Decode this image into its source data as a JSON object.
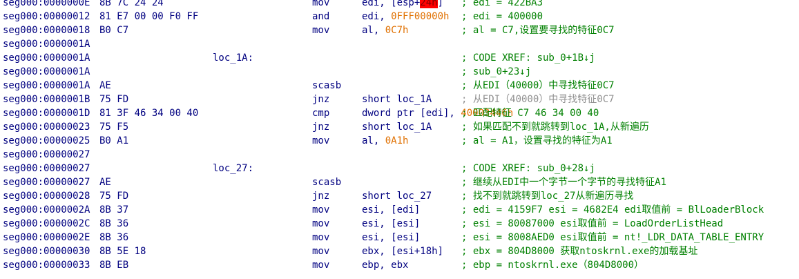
{
  "lines": [
    {
      "addr": "seg000:0000000E",
      "bytes": "8B 7C 24 24",
      "label": "",
      "mnem": "mov",
      "ops": [
        {
          "t": "edi, [esp+"
        },
        {
          "t": "24h",
          "k": "hl"
        },
        {
          "t": "]"
        }
      ],
      "comment": "; edi = 422BA3",
      "comment_style": "normal"
    },
    {
      "addr": "seg000:00000012",
      "bytes": "81 E7 00 00 F0 FF",
      "label": "",
      "mnem": "and",
      "ops": [
        {
          "t": "edi, "
        },
        {
          "t": "0FFF00000h",
          "k": "imm"
        }
      ],
      "comment": "; edi = 400000",
      "comment_style": "normal"
    },
    {
      "addr": "seg000:00000018",
      "bytes": "B0 C7",
      "label": "",
      "mnem": "mov",
      "ops": [
        {
          "t": "al, "
        },
        {
          "t": "0C7h",
          "k": "imm"
        }
      ],
      "comment": "; al = C7,设置要寻找的特征0C7",
      "comment_style": "normal"
    },
    {
      "addr": "seg000:0000001A",
      "bytes": "",
      "label": "",
      "mnem": "",
      "ops": [],
      "comment": "",
      "comment_style": "normal"
    },
    {
      "addr": "seg000:0000001A",
      "bytes": "",
      "label": "loc_1A:",
      "mnem": "",
      "ops": [],
      "comment": "; CODE XREF: sub_0+1B↓j",
      "comment_style": "normal"
    },
    {
      "addr": "seg000:0000001A",
      "bytes": "",
      "label": "",
      "mnem": "",
      "ops": [],
      "comment": "; sub_0+23↓j",
      "comment_style": "normal"
    },
    {
      "addr": "seg000:0000001A",
      "bytes": "AE",
      "label": "",
      "mnem": "scasb",
      "ops": [],
      "comment": "; 从EDI（40000）中寻找特征0C7",
      "comment_style": "normal"
    },
    {
      "addr": "seg000:0000001B",
      "bytes": "75 FD",
      "label": "",
      "mnem": "jnz",
      "ops": [
        {
          "t": "short loc_1A"
        }
      ],
      "comment": "; 从EDI（40000）中寻找特征0C7",
      "comment_style": "gray"
    },
    {
      "addr": "seg000:0000001D",
      "bytes": "81 3F 46 34 00 40",
      "label": "",
      "mnem": "cmp",
      "ops": [
        {
          "t": "dword ptr [edi], "
        },
        {
          "t": "40003446h",
          "k": "imm"
        }
      ],
      "comment": "; 匹配特征 C7 46 34 00 40",
      "comment_style": "normal"
    },
    {
      "addr": "seg000:00000023",
      "bytes": "75 F5",
      "label": "",
      "mnem": "jnz",
      "ops": [
        {
          "t": "short loc_1A"
        }
      ],
      "comment": "; 如果匹配不到就跳转到loc_1A,从新遍历",
      "comment_style": "normal"
    },
    {
      "addr": "seg000:00000025",
      "bytes": "B0 A1",
      "label": "",
      "mnem": "mov",
      "ops": [
        {
          "t": "al, "
        },
        {
          "t": "0A1h",
          "k": "imm"
        }
      ],
      "comment": "; al = A1，设置寻找的特征为A1",
      "comment_style": "normal"
    },
    {
      "addr": "seg000:00000027",
      "bytes": "",
      "label": "",
      "mnem": "",
      "ops": [],
      "comment": "",
      "comment_style": "normal"
    },
    {
      "addr": "seg000:00000027",
      "bytes": "",
      "label": "loc_27:",
      "mnem": "",
      "ops": [],
      "comment": "; CODE XREF: sub_0+28↓j",
      "comment_style": "normal"
    },
    {
      "addr": "seg000:00000027",
      "bytes": "AE",
      "label": "",
      "mnem": "scasb",
      "ops": [],
      "comment": "; 继续从EDI中一个字节一个字节的寻找特征A1",
      "comment_style": "normal"
    },
    {
      "addr": "seg000:00000028",
      "bytes": "75 FD",
      "label": "",
      "mnem": "jnz",
      "ops": [
        {
          "t": "short loc_27"
        }
      ],
      "comment": "; 找不到就跳转到loc_27从新遍历寻找",
      "comment_style": "normal"
    },
    {
      "addr": "seg000:0000002A",
      "bytes": "8B 37",
      "label": "",
      "mnem": "mov",
      "ops": [
        {
          "t": "esi, [edi]"
        }
      ],
      "comment": "; edi = 4159F7 esi = 4682E4 edi取值前 = BlLoaderBlock",
      "comment_style": "normal"
    },
    {
      "addr": "seg000:0000002C",
      "bytes": "8B 36",
      "label": "",
      "mnem": "mov",
      "ops": [
        {
          "t": "esi, [esi]"
        }
      ],
      "comment": "; esi = 80087000 esi取值前 = LoadOrderListHead",
      "comment_style": "normal"
    },
    {
      "addr": "seg000:0000002E",
      "bytes": "8B 36",
      "label": "",
      "mnem": "mov",
      "ops": [
        {
          "t": "esi, [esi]"
        }
      ],
      "comment": "; esi = 8008AED0 esi取值前 = nt!_LDR_DATA_TABLE_ENTRY",
      "comment_style": "normal"
    },
    {
      "addr": "seg000:00000030",
      "bytes": "8B 5E 18",
      "label": "",
      "mnem": "mov",
      "ops": [
        {
          "t": "ebx, [esi+18h]"
        }
      ],
      "comment": "; ebx = 804D8000 获取ntoskrnl.exe的加载基址",
      "comment_style": "normal"
    },
    {
      "addr": "seg000:00000033",
      "bytes": "8B EB",
      "label": "",
      "mnem": "mov",
      "ops": [
        {
          "t": "ebp, ebx"
        }
      ],
      "comment": "; ebp = ntoskrnl.exe（804D8000）",
      "comment_style": "normal"
    }
  ]
}
